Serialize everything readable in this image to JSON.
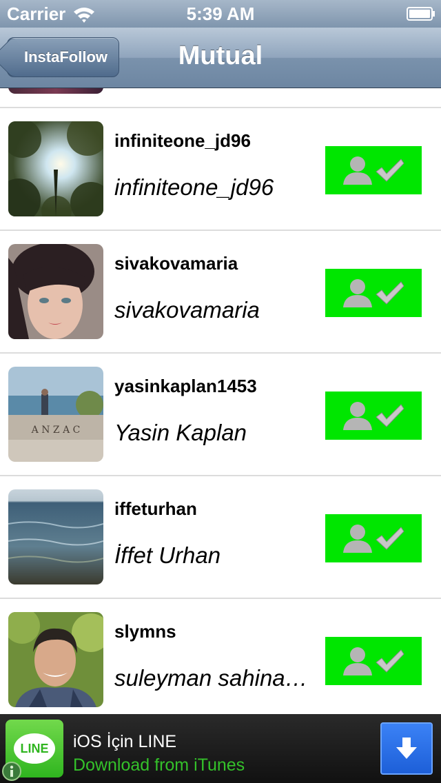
{
  "status_bar": {
    "carrier": "Carrier",
    "time": "5:39 AM",
    "icons": [
      "wifi-icon",
      "battery-icon"
    ]
  },
  "nav": {
    "back_label": "InstaFollow",
    "title": "Mutual"
  },
  "users": [
    {
      "username": "infiniteone_jd96",
      "full_name": "infiniteone_jd96"
    },
    {
      "username": "sivakovamaria",
      "full_name": "sivakovamaria"
    },
    {
      "username": "yasinkaplan1453",
      "full_name": "Yasin Kaplan"
    },
    {
      "username": "iffeturhan",
      "full_name": "İffet Urhan"
    },
    {
      "username": "slymns",
      "full_name": "suleyman sahina…"
    }
  ],
  "avatar_labels": {
    "anzac": "A N Z A C"
  },
  "follow_button": {
    "icon": "user-check-icon",
    "color": "#00e600"
  },
  "ad": {
    "logo_text": "LINE",
    "title": "iOS İçin LINE",
    "subtitle": "Download from iTunes",
    "colors": {
      "subtitle": "#34c12a",
      "button": "#1d5fd8"
    }
  }
}
